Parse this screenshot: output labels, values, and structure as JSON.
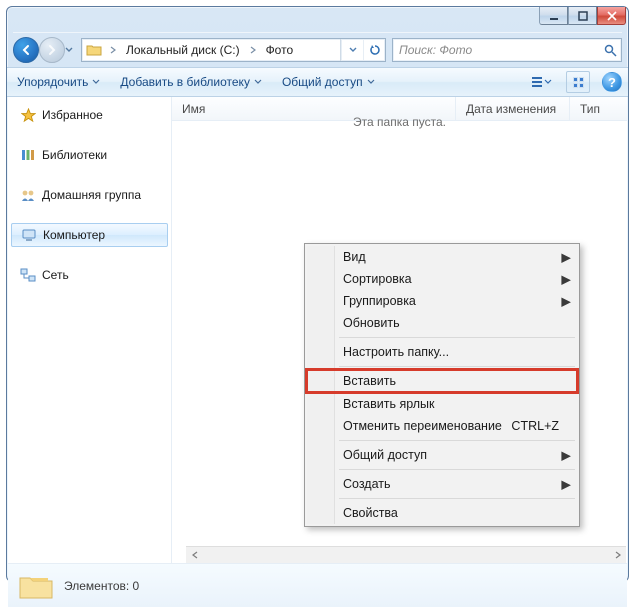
{
  "titlebar": {
    "minimize_label": "Minimize",
    "maximize_label": "Maximize",
    "close_label": "Close"
  },
  "nav": {
    "back_label": "Back",
    "forward_label": "Forward",
    "history_label": "Recent locations"
  },
  "breadcrumbs": {
    "drive": "Локальный диск (C:)",
    "folder": "Фото"
  },
  "addr_buttons": {
    "dropdown_label": "History",
    "refresh_label": "Refresh"
  },
  "search": {
    "placeholder": "Поиск: Фото"
  },
  "toolbar": {
    "organize": "Упорядочить",
    "add_to_library": "Добавить в библиотеку",
    "share": "Общий доступ",
    "view_label": "Change view",
    "preview_label": "Preview pane",
    "help_label": "Help"
  },
  "columns": {
    "name": "Имя",
    "date": "Дата изменения",
    "type": "Тип"
  },
  "sidebar": {
    "favorites": "Избранное",
    "libraries": "Библиотеки",
    "homegroup": "Домашняя группа",
    "computer": "Компьютер",
    "network": "Сеть"
  },
  "main": {
    "empty": "Эта папка пуста."
  },
  "status": {
    "text": "Элементов: 0"
  },
  "contextmenu": {
    "view": "Вид",
    "sort": "Сортировка",
    "group": "Группировка",
    "refresh": "Обновить",
    "customize": "Настроить папку...",
    "paste": "Вставить",
    "paste_shortcut": "Вставить ярлык",
    "undo_rename": "Отменить переименование",
    "undo_key": "CTRL+Z",
    "share": "Общий доступ",
    "new": "Создать",
    "properties": "Свойства"
  }
}
